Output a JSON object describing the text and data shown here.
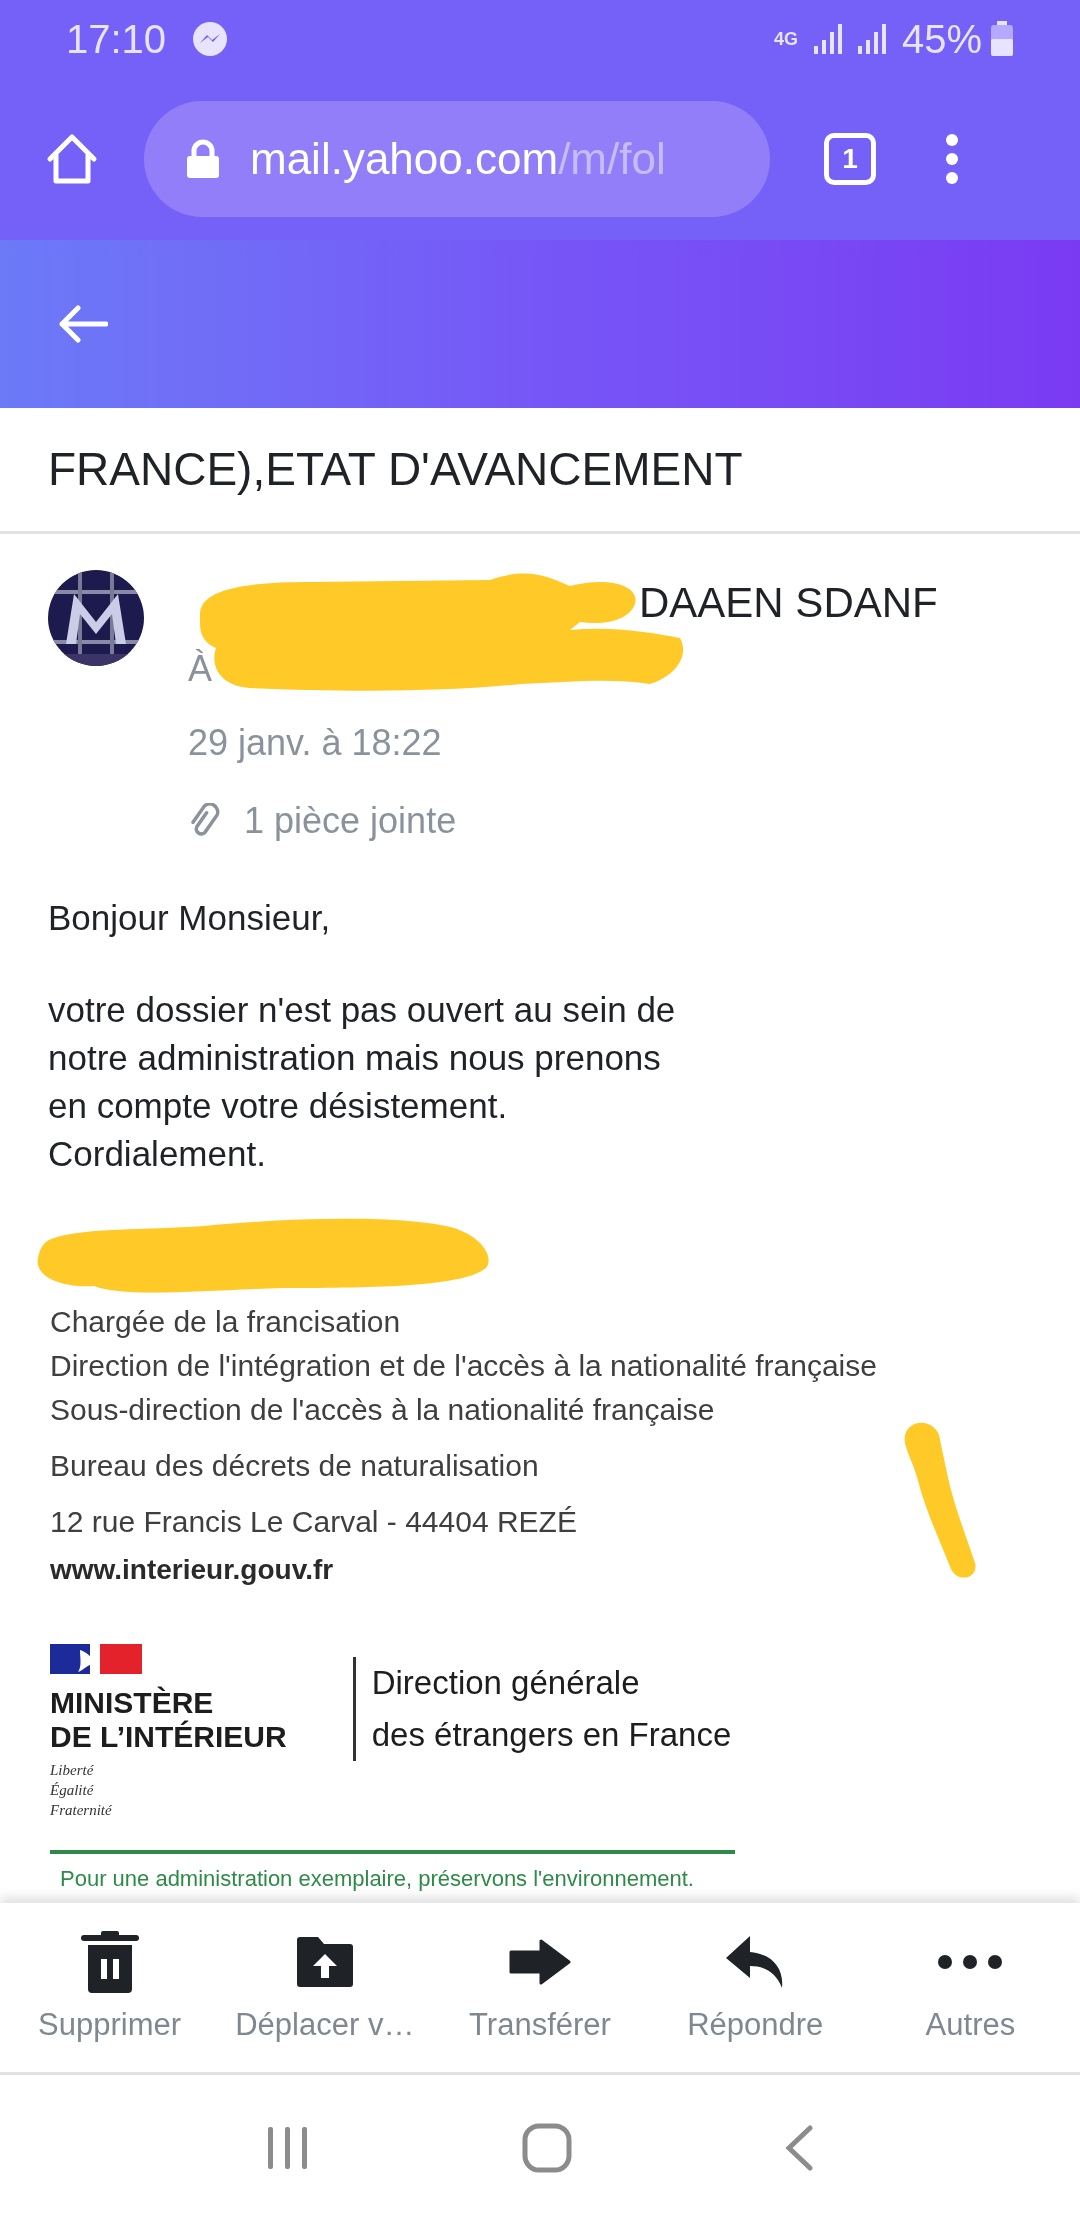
{
  "status_bar": {
    "time": "17:10",
    "network": "4G",
    "battery": "45%"
  },
  "browser": {
    "url_host": "mail.yahoo.com",
    "url_path": "/m/fol",
    "tab_count": "1"
  },
  "message": {
    "subject": "FRANCE),ETAT D'AVANCEMENT",
    "sender": "DAAEN SDANF",
    "recipient_prefix": "À",
    "date": "29 janv. à 18:22",
    "attachments": "1 pièce jointe",
    "body": [
      [
        "Bonjour Monsieur,"
      ],
      [
        "votre dossier n'est pas ouvert au sein de",
        "notre administration mais nous prenons",
        "en compte votre désistement.",
        "Cordialement."
      ]
    ]
  },
  "signature": {
    "lines": [
      "Chargée de la francisation",
      "Direction de l'intégration et de l'accès à la nationalité française",
      "Sous-direction de l'accès à la nationalité française",
      "Bureau des décrets de naturalisation",
      "12 rue Francis Le Carval - 44404 REZÉ"
    ],
    "website": "www.interieur.gouv.fr",
    "logo": {
      "ministry": [
        "MINISTÈRE",
        "DE L’INTÉRIEUR"
      ],
      "motto": [
        "Liberté",
        "Égalité",
        "Fraternité"
      ],
      "direction": [
        "Direction générale",
        "des étrangers en France"
      ]
    },
    "footer_note": "Pour une administration exemplaire, préservons l'environnement."
  },
  "actions": [
    {
      "kind": "delete",
      "label": "Supprimer"
    },
    {
      "kind": "move",
      "label": "Déplacer v…"
    },
    {
      "kind": "forward",
      "label": "Transférer"
    },
    {
      "kind": "reply",
      "label": "Répondre"
    },
    {
      "kind": "more",
      "label": "Autres"
    }
  ]
}
